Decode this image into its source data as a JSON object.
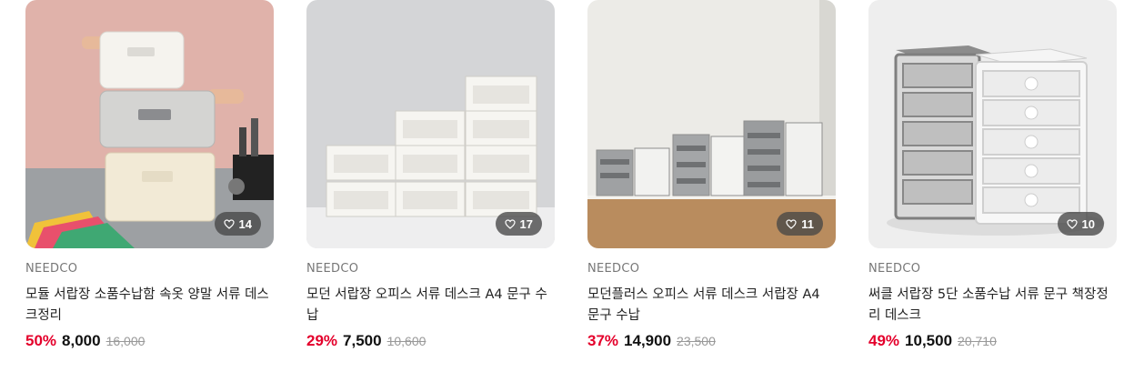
{
  "colors": {
    "discount": "#e4002b",
    "badge_bg": "#555555"
  },
  "products": [
    {
      "like_icon": "heart-outline-icon",
      "likes": "14",
      "brand": "NEEDCO",
      "title": "모듈 서랍장 소품수납함 속옷 양말 서류 데스크정리",
      "discount": "50%",
      "price": "8,000",
      "original_price": "16,000"
    },
    {
      "like_icon": "heart-outline-icon",
      "likes": "17",
      "brand": "NEEDCO",
      "title": "모던 서랍장 오피스 서류 데스크 A4 문구 수납",
      "discount": "29%",
      "price": "7,500",
      "original_price": "10,600"
    },
    {
      "like_icon": "heart-outline-icon",
      "likes": "11",
      "brand": "NEEDCO",
      "title": "모던플러스 오피스 서류 데스크 서랍장 A4 문구 수납",
      "discount": "37%",
      "price": "14,900",
      "original_price": "23,500"
    },
    {
      "like_icon": "heart-outline-icon",
      "likes": "10",
      "brand": "NEEDCO",
      "title": "써클 서랍장 5단 소품수납 서류 문구 책장정리 데스크",
      "discount": "49%",
      "price": "10,500",
      "original_price": "20,710"
    }
  ]
}
